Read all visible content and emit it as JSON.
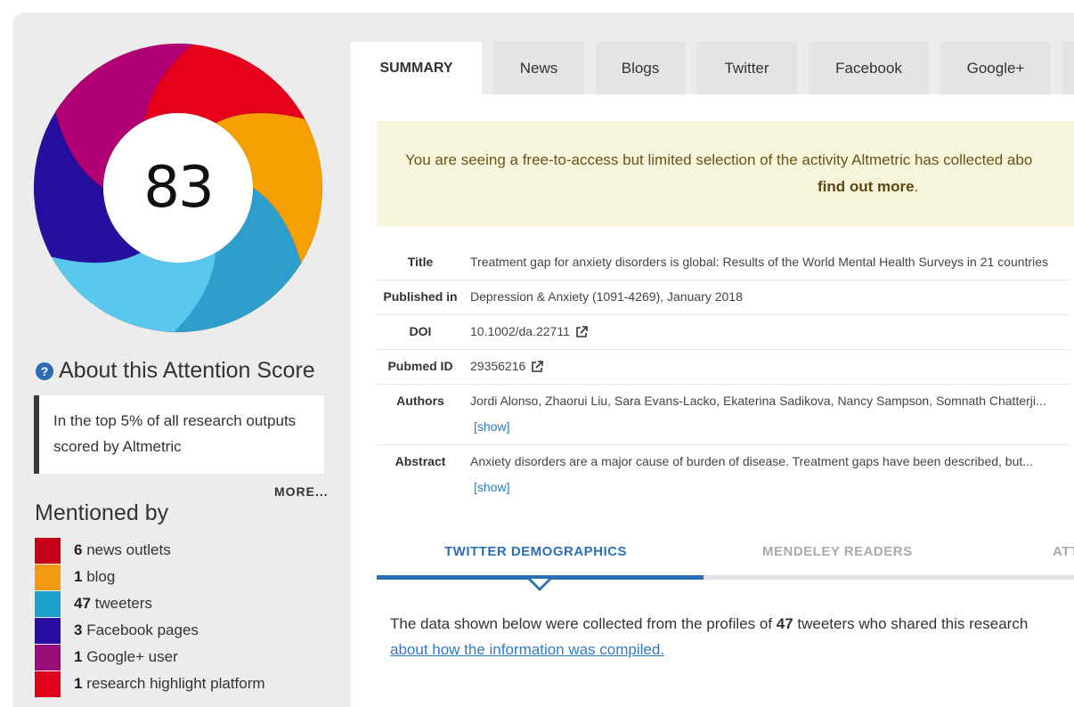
{
  "score": "83",
  "donut_colors": [
    "#e5001c",
    "#f5a000",
    "#2e9fcc",
    "#5ac8ee",
    "#240f9e",
    "#b10074"
  ],
  "about": {
    "icon": "help-icon",
    "heading": "About this Attention Score",
    "callout": "In the top 5% of all research outputs scored by Altmetric",
    "more": "MORE..."
  },
  "mentioned": {
    "heading": "Mentioned by",
    "items": [
      {
        "count": "6",
        "label": "news outlets",
        "color": "#c4001a"
      },
      {
        "count": "1",
        "label": "blog",
        "color": "#f39a12"
      },
      {
        "count": "47",
        "label": "tweeters",
        "color": "#1e9fcc"
      },
      {
        "count": "3",
        "label": "Facebook pages",
        "color": "#2a0ea4"
      },
      {
        "count": "1",
        "label": "Google+ user",
        "color": "#990d79"
      },
      {
        "count": "1",
        "label": "research highlight platform",
        "color": "#e0001b"
      }
    ]
  },
  "tabs": [
    "SUMMARY",
    "News",
    "Blogs",
    "Twitter",
    "Facebook",
    "Google+"
  ],
  "notice": {
    "text": "You are seeing a free-to-access but limited selection of the activity Altmetric has collected abo",
    "link": "find out more",
    "end": "."
  },
  "meta": {
    "title_label": "Title",
    "title": "Treatment gap for anxiety disorders is global: Results of the World Mental Health Surveys in 21 countries",
    "published_label": "Published in",
    "published": "Depression & Anxiety (1091-4269), January 2018",
    "doi_label": "DOI",
    "doi": "10.1002/da.22711",
    "pubmed_label": "Pubmed ID",
    "pubmed": "29356216",
    "authors_label": "Authors",
    "authors": "Jordi Alonso, Zhaorui Liu, Sara Evans-Lacko, Ekaterina Sadikova, Nancy Sampson, Somnath Chatterji...",
    "abstract_label": "Abstract",
    "abstract": "Anxiety disorders are a major cause of burden of disease. Treatment gaps have been described, but...",
    "show": "[show]"
  },
  "sub_tabs": {
    "twitter": "TWITTER DEMOGRAPHICS",
    "mendeley": "MENDELEY READERS",
    "third": "ATT"
  },
  "desc": {
    "pre": "The data shown below were collected from the profiles of ",
    "count": "47",
    "post": " tweeters who shared this research",
    "link": "about how the information was compiled."
  }
}
